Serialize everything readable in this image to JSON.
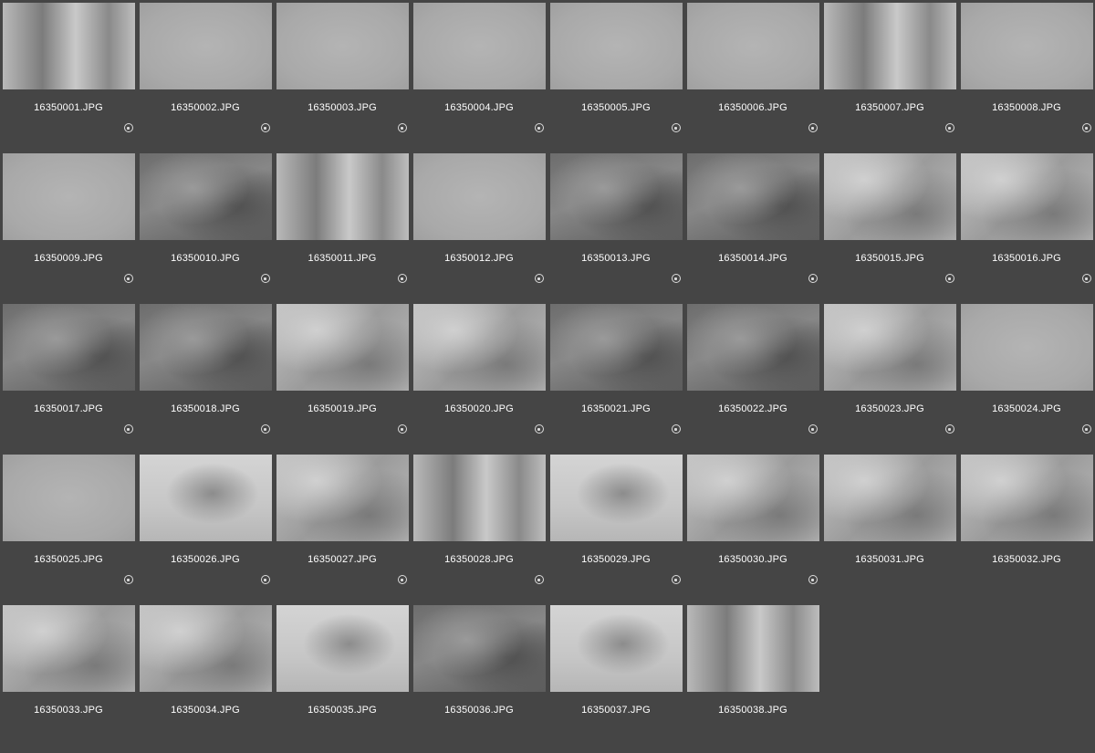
{
  "browser": {
    "items": [
      {
        "name": "16350001.JPG",
        "style": "photo-mixed",
        "locked": true
      },
      {
        "name": "16350002.JPG",
        "style": "blank",
        "locked": true
      },
      {
        "name": "16350003.JPG",
        "style": "blank",
        "locked": true
      },
      {
        "name": "16350004.JPG",
        "style": "blank",
        "locked": true
      },
      {
        "name": "16350005.JPG",
        "style": "blank",
        "locked": true
      },
      {
        "name": "16350006.JPG",
        "style": "blank",
        "locked": true
      },
      {
        "name": "16350007.JPG",
        "style": "photo-mixed",
        "locked": true
      },
      {
        "name": "16350008.JPG",
        "style": "blank",
        "locked": true
      },
      {
        "name": "16350009.JPG",
        "style": "blank",
        "locked": true
      },
      {
        "name": "16350010.JPG",
        "style": "photo-dark",
        "locked": true
      },
      {
        "name": "16350011.JPG",
        "style": "photo-mixed",
        "locked": true
      },
      {
        "name": "16350012.JPG",
        "style": "blank",
        "locked": true
      },
      {
        "name": "16350013.JPG",
        "style": "photo-dark",
        "locked": true
      },
      {
        "name": "16350014.JPG",
        "style": "photo-dark",
        "locked": true
      },
      {
        "name": "16350015.JPG",
        "style": "photo-light",
        "locked": true
      },
      {
        "name": "16350016.JPG",
        "style": "photo-light",
        "locked": true
      },
      {
        "name": "16350017.JPG",
        "style": "photo-dark",
        "locked": true
      },
      {
        "name": "16350018.JPG",
        "style": "photo-dark",
        "locked": true
      },
      {
        "name": "16350019.JPG",
        "style": "photo-light",
        "locked": true
      },
      {
        "name": "16350020.JPG",
        "style": "photo-light",
        "locked": true
      },
      {
        "name": "16350021.JPG",
        "style": "photo-dark",
        "locked": true
      },
      {
        "name": "16350022.JPG",
        "style": "photo-dark",
        "locked": true
      },
      {
        "name": "16350023.JPG",
        "style": "photo-light",
        "locked": true
      },
      {
        "name": "16350024.JPG",
        "style": "blank",
        "locked": true
      },
      {
        "name": "16350025.JPG",
        "style": "blank",
        "locked": true
      },
      {
        "name": "16350026.JPG",
        "style": "photo-white",
        "locked": true
      },
      {
        "name": "16350027.JPG",
        "style": "photo-light",
        "locked": true
      },
      {
        "name": "16350028.JPG",
        "style": "photo-mixed",
        "locked": true
      },
      {
        "name": "16350029.JPG",
        "style": "photo-white",
        "locked": true
      },
      {
        "name": "16350030.JPG",
        "style": "photo-light",
        "locked": true
      },
      {
        "name": "16350031.JPG",
        "style": "photo-light",
        "locked": false
      },
      {
        "name": "16350032.JPG",
        "style": "photo-light",
        "locked": false
      },
      {
        "name": "16350033.JPG",
        "style": "photo-light",
        "locked": false
      },
      {
        "name": "16350034.JPG",
        "style": "photo-light",
        "locked": false
      },
      {
        "name": "16350035.JPG",
        "style": "photo-white",
        "locked": false
      },
      {
        "name": "16350036.JPG",
        "style": "photo-dark",
        "locked": false
      },
      {
        "name": "16350037.JPG",
        "style": "photo-white",
        "locked": false
      },
      {
        "name": "16350038.JPG",
        "style": "photo-mixed",
        "locked": false
      }
    ]
  }
}
